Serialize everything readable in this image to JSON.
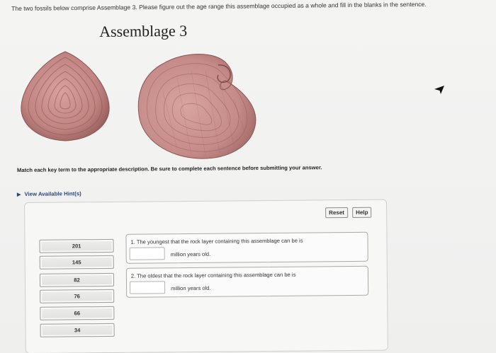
{
  "header": {
    "intro": "The two fossils below comprise Assemblage 3. Please figure out the age range this assemblage occupied as a whole and fill in the blanks in the sentence.",
    "title": "Assemblage 3"
  },
  "activity": {
    "instruction": "Match each key term to the appropriate description. Be sure to complete each sentence before submitting your answer.",
    "hints_label": "View Available Hint(s)",
    "reset_label": "Reset",
    "help_label": "Help",
    "terms": [
      "201",
      "145",
      "82",
      "76",
      "66",
      "34"
    ],
    "questions": [
      {
        "text": "1. The youngest that the rock layer containing this assemblage can be is",
        "tail": "million years old."
      },
      {
        "text": "2. The oldest that the rock layer containing this assemblage can be is",
        "tail": "million years old."
      }
    ]
  },
  "colors": {
    "shell_fill": "#c98e8c",
    "shell_ridge": "#8f5553",
    "hint_link": "#2a4a7a"
  },
  "icons": {
    "hint_toggle": "triangle-right-icon",
    "cursor": "mouse-cursor-icon"
  }
}
